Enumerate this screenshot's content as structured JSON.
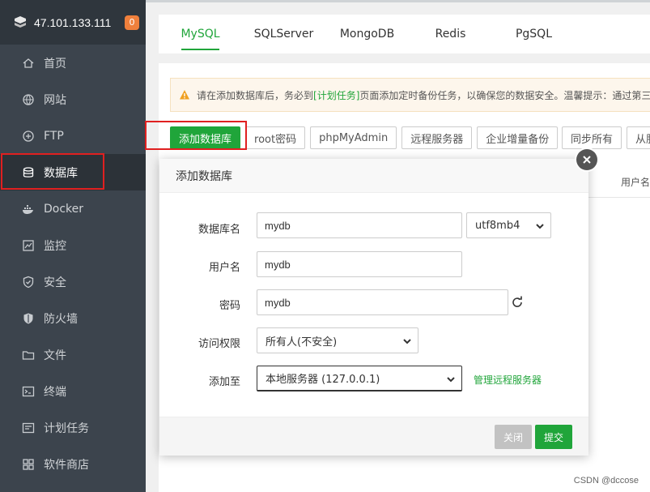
{
  "sidebar": {
    "ip": "47.101.133.111",
    "badge": "0",
    "items": [
      {
        "label": "首页",
        "icon": "home-icon"
      },
      {
        "label": "网站",
        "icon": "globe-icon"
      },
      {
        "label": "FTP",
        "icon": "ftp-icon"
      },
      {
        "label": "数据库",
        "icon": "database-icon"
      },
      {
        "label": "Docker",
        "icon": "docker-icon"
      },
      {
        "label": "监控",
        "icon": "monitor-icon"
      },
      {
        "label": "安全",
        "icon": "shield-icon"
      },
      {
        "label": "防火墙",
        "icon": "firewall-icon"
      },
      {
        "label": "文件",
        "icon": "folder-icon"
      },
      {
        "label": "终端",
        "icon": "terminal-icon"
      },
      {
        "label": "计划任务",
        "icon": "clock-icon"
      },
      {
        "label": "软件商店",
        "icon": "store-icon"
      }
    ],
    "active_index": 3
  },
  "tabs": [
    "MySQL",
    "SQLServer",
    "MongoDB",
    "Redis",
    "PgSQL"
  ],
  "notice": {
    "prefix": "请在添加数据库后，务必到",
    "link": "[计划任务]",
    "suffix": "页面添加定时备份任务，以确保您的数据安全。温馨提示：通过第三"
  },
  "toolbar": {
    "add_db": "添加数据库",
    "root_pwd": "root密码",
    "phpmyadmin": "phpMyAdmin",
    "remote_server": "远程服务器",
    "enterprise_backup": "企业增量备份",
    "sync_all": "同步所有",
    "from_server": "从服"
  },
  "table": {
    "col_user": "用户名"
  },
  "dialog": {
    "title": "添加数据库",
    "db_name_label": "数据库名",
    "db_name_value": "mydb",
    "charset_value": "utf8mb4",
    "username_label": "用户名",
    "username_value": "mydb",
    "password_label": "密码",
    "password_value": "mydb",
    "access_label": "访问权限",
    "access_value": "所有人(不安全)",
    "add_to_label": "添加至",
    "add_to_value": "本地服务器 (127.0.0.1)",
    "manage_remote": "管理远程服务器",
    "close_btn": "关闭",
    "submit_btn": "提交"
  },
  "watermark": "CSDN @dccose",
  "colors": {
    "accent": "#20a53a",
    "sidebar": "#3c444d",
    "highlight": "#e02020"
  }
}
